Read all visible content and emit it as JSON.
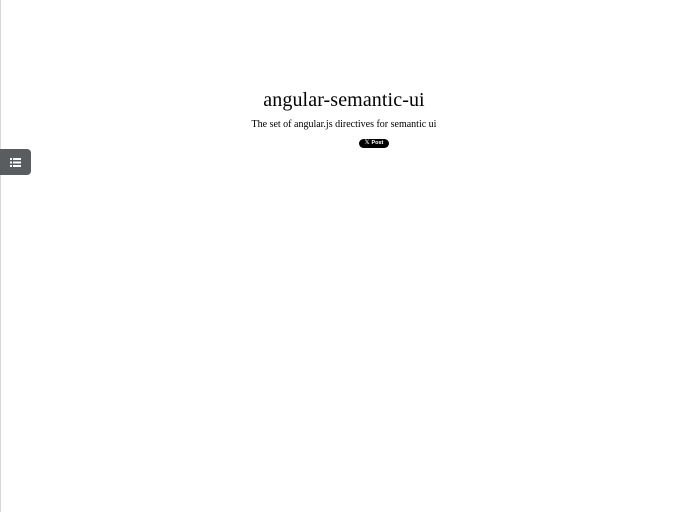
{
  "page": {
    "title": "angular-semantic-ui",
    "tagline": "The set of angular.js directives for semantic ui"
  },
  "sidebar_toggle": {
    "icon": "list-icon",
    "color": "#5a5d60"
  },
  "share": {
    "button_icon": "x-logo-icon",
    "button_glyph": "𝕏",
    "button_label": "Post",
    "color": "#000000"
  }
}
